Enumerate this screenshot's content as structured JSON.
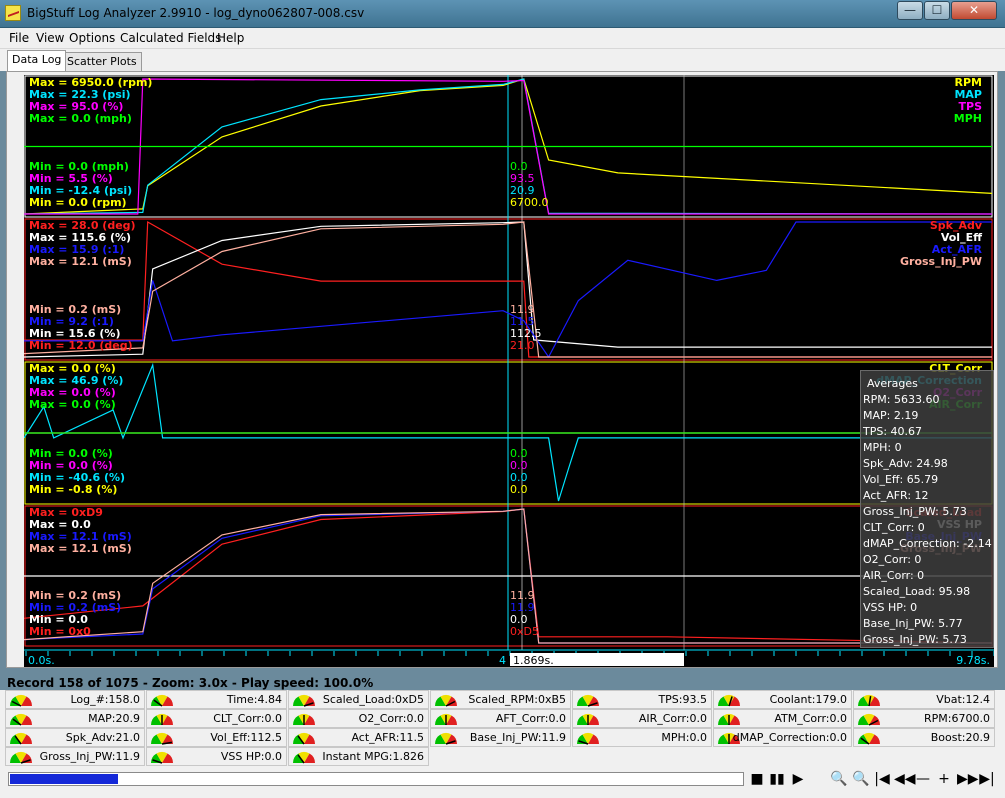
{
  "window": {
    "title": "BigStuff Log Analyzer 2.9910 - log_dyno062807-008.csv",
    "minimize": "—",
    "maximize": "☐",
    "close": "✕"
  },
  "menu": [
    "File",
    "View",
    "Options",
    "Calculated Fields",
    "Help"
  ],
  "tabs": [
    {
      "label": "Data Log",
      "active": true
    },
    {
      "label": "Scatter Plots",
      "active": false
    }
  ],
  "colors": {
    "yellow": "#ffff00",
    "cyan": "#00e5ff",
    "magenta": "#ff00ff",
    "green": "#00ff00",
    "red": "#ff2020",
    "white": "#ffffff",
    "blue": "#1a1aff",
    "salmon": "#ffb0a0",
    "olive": "#999933"
  },
  "panels": [
    {
      "left_max": [
        {
          "text": "Max = 6950.0 (rpm)",
          "color": "#ffff00"
        },
        {
          "text": "Max = 22.3 (psi)",
          "color": "#00e5ff"
        },
        {
          "text": "Max = 95.0 (%)",
          "color": "#ff00ff"
        },
        {
          "text": "Max = 0.0 (mph)",
          "color": "#00ff00"
        }
      ],
      "left_min": [
        {
          "text": "Min = 0.0 (mph)",
          "color": "#00ff00"
        },
        {
          "text": "Min = 5.5 (%)",
          "color": "#ff00ff"
        },
        {
          "text": "Min = -12.4 (psi)",
          "color": "#00e5ff"
        },
        {
          "text": "Min = 0.0 (rpm)",
          "color": "#ffff00"
        }
      ],
      "legend": [
        {
          "text": "RPM",
          "color": "#ffff00"
        },
        {
          "text": "MAP",
          "color": "#00e5ff"
        },
        {
          "text": "TPS",
          "color": "#ff00ff"
        },
        {
          "text": "MPH",
          "color": "#00ff00"
        }
      ],
      "cursor_values": [
        {
          "text": "0.0",
          "color": "#00ff00"
        },
        {
          "text": "93.5",
          "color": "#ff00ff"
        },
        {
          "text": "20.9",
          "color": "#00e5ff"
        },
        {
          "text": "6700.0",
          "color": "#ffff00"
        }
      ]
    },
    {
      "left_max": [
        {
          "text": "Max = 28.0 (deg)",
          "color": "#ff2020"
        },
        {
          "text": "Max = 115.6 (%)",
          "color": "#ffffff"
        },
        {
          "text": "Max = 15.9 (:1)",
          "color": "#1a1aff"
        },
        {
          "text": "Max = 12.1 (mS)",
          "color": "#ffb0a0"
        }
      ],
      "left_min": [
        {
          "text": "Min = 0.2 (mS)",
          "color": "#ffb0a0"
        },
        {
          "text": "Min = 9.2 (:1)",
          "color": "#1a1aff"
        },
        {
          "text": "Min = 15.6 (%)",
          "color": "#ffffff"
        },
        {
          "text": "Min = 12.0 (deg)",
          "color": "#ff2020"
        }
      ],
      "legend": [
        {
          "text": "Spk_Adv",
          "color": "#ff2020"
        },
        {
          "text": "Vol_Eff",
          "color": "#ffffff"
        },
        {
          "text": "Act_AFR",
          "color": "#1a1aff"
        },
        {
          "text": "Gross_Inj_PW",
          "color": "#ffb0a0"
        }
      ],
      "cursor_values": [
        {
          "text": "11.9",
          "color": "#ffb0a0"
        },
        {
          "text": "11.5",
          "color": "#1a1aff"
        },
        {
          "text": "112.5",
          "color": "#ffffff"
        },
        {
          "text": "21.0",
          "color": "#ff2020"
        }
      ]
    },
    {
      "left_max": [
        {
          "text": "Max = 0.0 (%)",
          "color": "#ffff00"
        },
        {
          "text": "Max = 46.9 (%)",
          "color": "#00e5ff"
        },
        {
          "text": "Max = 0.0 (%)",
          "color": "#ff00ff"
        },
        {
          "text": "Max = 0.0 (%)",
          "color": "#00ff00"
        }
      ],
      "left_min": [
        {
          "text": "Min = 0.0 (%)",
          "color": "#00ff00"
        },
        {
          "text": "Min = 0.0 (%)",
          "color": "#ff00ff"
        },
        {
          "text": "Min = -40.6 (%)",
          "color": "#00e5ff"
        },
        {
          "text": "Min = -0.8 (%)",
          "color": "#ffff00"
        }
      ],
      "legend": [
        {
          "text": "CLT_Corr",
          "color": "#ffff00"
        },
        {
          "text": "dMAP_Correction",
          "color": "#00e5ff"
        },
        {
          "text": "O2_Corr",
          "color": "#ff00ff"
        },
        {
          "text": "AIR_Corr",
          "color": "#00ff00"
        }
      ],
      "cursor_values": [
        {
          "text": "0.0",
          "color": "#00ff00"
        },
        {
          "text": "0.0",
          "color": "#ff00ff"
        },
        {
          "text": "0.0",
          "color": "#00e5ff"
        },
        {
          "text": "0.0",
          "color": "#ffff00"
        }
      ]
    },
    {
      "left_max": [
        {
          "text": "Max = 0xD9",
          "color": "#ff2020"
        },
        {
          "text": "Max = 0.0",
          "color": "#ffffff"
        },
        {
          "text": "Max = 12.1 (mS)",
          "color": "#1a1aff"
        },
        {
          "text": "Max = 12.1 (mS)",
          "color": "#ffb0a0"
        }
      ],
      "left_min": [
        {
          "text": "Min = 0.2 (mS)",
          "color": "#ffb0a0"
        },
        {
          "text": "Min = 0.2 (mS)",
          "color": "#1a1aff"
        },
        {
          "text": "Min = 0.0",
          "color": "#ffffff"
        },
        {
          "text": "Min = 0x0",
          "color": "#ff2020"
        }
      ],
      "legend": [
        {
          "text": "Scaled_Load",
          "color": "#ff2020"
        },
        {
          "text": "VSS HP",
          "color": "#ffffff"
        },
        {
          "text": "Base_Inj_PW",
          "color": "#1a1aff"
        },
        {
          "text": "Gross_Inj_PW",
          "color": "#ffb0a0"
        }
      ],
      "cursor_values": [
        {
          "text": "11.9",
          "color": "#ffb0a0"
        },
        {
          "text": "11.9",
          "color": "#1a1aff"
        },
        {
          "text": "0.0",
          "color": "#ffffff"
        },
        {
          "text": "0xD5",
          "color": "#ff2020"
        }
      ]
    }
  ],
  "time_axis": {
    "start": "0.0s.",
    "end": "9.78s.",
    "cursor_time": "1.869s.",
    "cursor_marker": "4"
  },
  "averages": {
    "title": "Averages",
    "rows": [
      "RPM: 5633.60",
      "MAP: 2.19",
      "TPS: 40.67",
      "MPH: 0",
      "Spk_Adv: 24.98",
      "Vol_Eff: 65.79",
      "Act_AFR: 12",
      "Gross_Inj_PW: 5.73",
      "CLT_Corr: 0",
      "dMAP_Correction: -2.14",
      "O2_Corr: 0",
      "AIR_Corr: 0",
      "Scaled_Load: 95.98",
      "VSS HP: 0",
      "Base_Inj_PW: 5.77",
      "Gross_Inj_PW: 5.73"
    ]
  },
  "status": "Record 158 of 1075 - Zoom: 3.0x - Play speed: 100.0%",
  "gauges": [
    [
      "Log_#:158.0",
      "Time:4.84",
      "Scaled_Load:0xD5",
      "Scaled_RPM:0xB5",
      "TPS:93.5",
      "Coolant:179.0",
      "Vbat:12.4"
    ],
    [
      "MAP:20.9",
      "CLT_Corr:0.0",
      "O2_Corr:0.0",
      "AFT_Corr:0.0",
      "AIR_Corr:0.0",
      "ATM_Corr:0.0",
      "RPM:6700.0"
    ],
    [
      "Spk_Adv:21.0",
      "Vol_Eff:112.5",
      "Act_AFR:11.5",
      "Base_Inj_PW:11.9",
      "MPH:0.0",
      "dMAP_Correction:0.0",
      "Boost:20.9"
    ],
    [
      "Gross_Inj_PW:11.9",
      "VSS HP:0.0",
      "Instant MPG:1.826"
    ]
  ],
  "gauge_levels": [
    [
      0.15,
      0.2,
      0.9,
      0.85,
      0.9,
      0.6,
      0.55
    ],
    [
      0.2,
      0.5,
      0.5,
      0.5,
      0.5,
      0.5,
      0.85
    ],
    [
      0.3,
      0.95,
      0.3,
      0.9,
      0.1,
      0.5,
      0.2
    ],
    [
      0.9,
      0.1,
      0.3
    ]
  ],
  "playback": {
    "progress": 0.147,
    "controls": [
      "■",
      "▮▮",
      "▶",
      "🔍",
      "🔍",
      "|◀",
      "◀◀",
      "—",
      "+",
      "▶▶",
      "▶|"
    ]
  },
  "chart_data": {
    "type": "line",
    "x_range_s": [
      0.0,
      9.78
    ],
    "cursor_s": 1.869,
    "panels": [
      {
        "series": [
          {
            "name": "RPM",
            "color": "#ffff00",
            "points": [
              [
                0,
                1700
              ],
              [
                1.2,
                1900
              ],
              [
                1.25,
                2800
              ],
              [
                2.0,
                4700
              ],
              [
                3.0,
                5900
              ],
              [
                4.0,
                6500
              ],
              [
                4.84,
                6700
              ],
              [
                5.05,
                6950
              ],
              [
                5.3,
                3800
              ],
              [
                6.0,
                3300
              ],
              [
                9.78,
                2500
              ]
            ]
          },
          {
            "name": "MAP",
            "color": "#00e5ff",
            "points": [
              [
                0,
                -12.4
              ],
              [
                1.2,
                -12
              ],
              [
                1.25,
                -5
              ],
              [
                2.0,
                10
              ],
              [
                3.0,
                17
              ],
              [
                4.0,
                19.5
              ],
              [
                4.84,
                20.9
              ],
              [
                5.05,
                22.3
              ],
              [
                5.3,
                -12.2
              ],
              [
                9.78,
                -12.4
              ]
            ]
          },
          {
            "name": "TPS",
            "color": "#ff00ff",
            "points": [
              [
                0,
                5.5
              ],
              [
                1.15,
                5.5
              ],
              [
                1.2,
                95
              ],
              [
                4.84,
                93.5
              ],
              [
                5.05,
                94
              ],
              [
                5.3,
                5.5
              ],
              [
                9.78,
                5.5
              ]
            ]
          },
          {
            "name": "MPH",
            "color": "#00ff00",
            "points": [
              [
                0,
                0
              ],
              [
                9.78,
                0
              ]
            ]
          }
        ]
      },
      {
        "series": [
          {
            "name": "Spk_Adv",
            "color": "#ff2020",
            "points": [
              [
                0,
                14
              ],
              [
                1.2,
                14
              ],
              [
                1.25,
                28
              ],
              [
                2.0,
                23
              ],
              [
                3.0,
                21
              ],
              [
                4.84,
                21
              ],
              [
                5.05,
                21
              ],
              [
                5.1,
                12
              ],
              [
                6.5,
                12
              ],
              [
                6.6,
                12
              ],
              [
                9.78,
                12
              ]
            ]
          },
          {
            "name": "Vol_Eff",
            "color": "#ffffff",
            "points": [
              [
                0,
                18
              ],
              [
                1.2,
                20
              ],
              [
                1.3,
                80
              ],
              [
                2.0,
                100
              ],
              [
                3.0,
                110
              ],
              [
                4.84,
                112.5
              ],
              [
                5.05,
                113
              ],
              [
                5.15,
                30
              ],
              [
                6.0,
                25
              ],
              [
                9.78,
                25
              ]
            ]
          },
          {
            "name": "Act_AFR",
            "color": "#1a1aff",
            "points": [
              [
                0,
                10
              ],
              [
                1.2,
                10
              ],
              [
                1.3,
                13
              ],
              [
                1.5,
                10
              ],
              [
                2.0,
                10.3
              ],
              [
                4.84,
                11.5
              ],
              [
                5.05,
                11
              ],
              [
                5.3,
                9.2
              ],
              [
                5.6,
                12
              ],
              [
                6.1,
                14
              ],
              [
                7.0,
                13
              ],
              [
                7.5,
                13.5
              ],
              [
                7.8,
                15.9
              ],
              [
                9.78,
                15.9
              ]
            ]
          },
          {
            "name": "Gross_Inj_PW",
            "color": "#ffb0a0",
            "points": [
              [
                0,
                0.5
              ],
              [
                1.2,
                1
              ],
              [
                1.3,
                6
              ],
              [
                2.0,
                9.5
              ],
              [
                3.0,
                11.5
              ],
              [
                4.84,
                11.9
              ],
              [
                5.05,
                12.1
              ],
              [
                5.2,
                0.2
              ],
              [
                9.78,
                0.2
              ]
            ]
          }
        ]
      },
      {
        "series": [
          {
            "name": "CLT_Corr",
            "color": "#ffff00",
            "points": [
              [
                0,
                0
              ],
              [
                9.78,
                0
              ]
            ]
          },
          {
            "name": "dMAP_Correction",
            "color": "#00e5ff",
            "points": [
              [
                0,
                0
              ],
              [
                0.2,
                20
              ],
              [
                0.3,
                0
              ],
              [
                0.9,
                18
              ],
              [
                1.0,
                0
              ],
              [
                1.3,
                46.9
              ],
              [
                1.4,
                0
              ],
              [
                5.3,
                0
              ],
              [
                5.4,
                -40.6
              ],
              [
                5.5,
                -20
              ],
              [
                5.6,
                0
              ],
              [
                9.78,
                0
              ]
            ]
          },
          {
            "name": "O2_Corr",
            "color": "#ff00ff",
            "points": [
              [
                0,
                0
              ],
              [
                9.78,
                0
              ]
            ]
          },
          {
            "name": "AIR_Corr",
            "color": "#00ff00",
            "points": [
              [
                0,
                0
              ],
              [
                9.78,
                0
              ]
            ]
          }
        ]
      },
      {
        "series": [
          {
            "name": "Scaled_Load",
            "color": "#ff2020",
            "points": [
              [
                0,
                40
              ],
              [
                1.2,
                60
              ],
              [
                2.0,
                160
              ],
              [
                3.0,
                200
              ],
              [
                4.84,
                213
              ],
              [
                5.05,
                217
              ],
              [
                5.2,
                10
              ],
              [
                6.5,
                10
              ],
              [
                9.78,
                0
              ]
            ]
          },
          {
            "name": "VSS HP",
            "color": "#ffffff",
            "points": [
              [
                0,
                0
              ],
              [
                9.78,
                0
              ]
            ]
          },
          {
            "name": "Base_Inj_PW",
            "color": "#1a1aff",
            "points": [
              [
                0,
                0.5
              ],
              [
                1.2,
                1
              ],
              [
                1.3,
                5
              ],
              [
                2.0,
                9.5
              ],
              [
                3.0,
                11.5
              ],
              [
                4.84,
                11.9
              ],
              [
                5.05,
                12.1
              ],
              [
                5.2,
                0.2
              ],
              [
                9.78,
                0.2
              ]
            ]
          },
          {
            "name": "Gross_Inj_PW",
            "color": "#ffb0a0",
            "points": [
              [
                0,
                0.5
              ],
              [
                1.2,
                1.2
              ],
              [
                1.3,
                5.5
              ],
              [
                2.0,
                9.8
              ],
              [
                3.0,
                11.6
              ],
              [
                4.84,
                11.9
              ],
              [
                5.05,
                12.1
              ],
              [
                5.2,
                0.2
              ],
              [
                9.78,
                0.2
              ]
            ]
          }
        ]
      }
    ]
  }
}
